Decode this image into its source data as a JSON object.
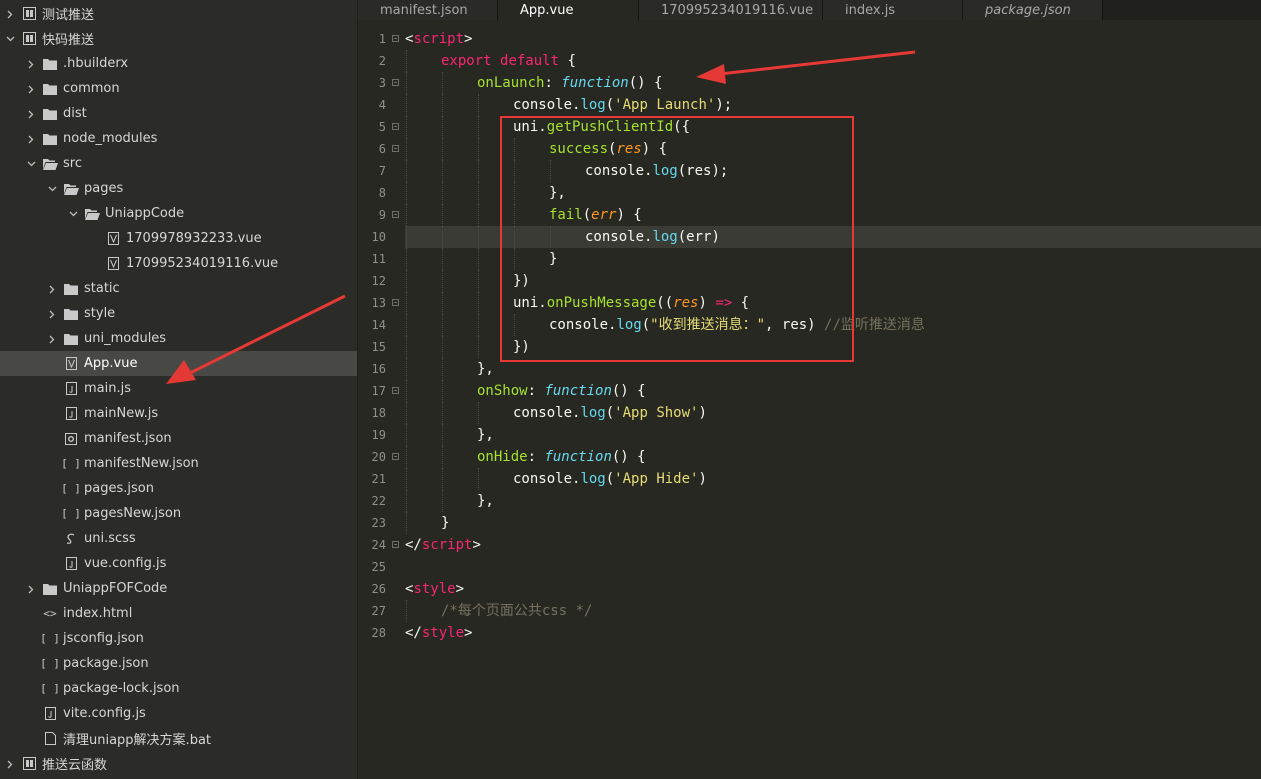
{
  "sidebar": {
    "rows": [
      {
        "label": "测试推送",
        "depth": 0,
        "expanded": false,
        "icon": "project-icon"
      },
      {
        "label": "快码推送",
        "depth": 0,
        "expanded": true,
        "icon": "project-icon"
      },
      {
        "label": ".hbuilderx",
        "depth": 1,
        "expanded": false,
        "icon": "folder-icon"
      },
      {
        "label": "common",
        "depth": 1,
        "expanded": false,
        "icon": "folder-icon"
      },
      {
        "label": "dist",
        "depth": 1,
        "expanded": false,
        "icon": "folder-icon"
      },
      {
        "label": "node_modules",
        "depth": 1,
        "expanded": false,
        "icon": "folder-icon"
      },
      {
        "label": "src",
        "depth": 1,
        "expanded": true,
        "icon": "folder-open-icon"
      },
      {
        "label": "pages",
        "depth": 2,
        "expanded": true,
        "icon": "folder-open-icon"
      },
      {
        "label": "UniappCode",
        "depth": 3,
        "expanded": true,
        "icon": "folder-open-icon"
      },
      {
        "label": "1709978932233.vue",
        "depth": 4,
        "icon": "vue-file-icon"
      },
      {
        "label": "170995234019116.vue",
        "depth": 4,
        "icon": "vue-file-icon"
      },
      {
        "label": "static",
        "depth": 2,
        "expanded": false,
        "icon": "folder-icon"
      },
      {
        "label": "style",
        "depth": 2,
        "expanded": false,
        "icon": "folder-icon"
      },
      {
        "label": "uni_modules",
        "depth": 2,
        "expanded": false,
        "icon": "folder-icon"
      },
      {
        "label": "App.vue",
        "depth": 2,
        "icon": "vue-file-icon",
        "selected": true
      },
      {
        "label": "main.js",
        "depth": 2,
        "icon": "js-file-icon"
      },
      {
        "label": "mainNew.js",
        "depth": 2,
        "icon": "js-file-icon"
      },
      {
        "label": "manifest.json",
        "depth": 2,
        "icon": "manifest-file-icon"
      },
      {
        "label": "manifestNew.json",
        "depth": 2,
        "icon": "json-file-icon"
      },
      {
        "label": "pages.json",
        "depth": 2,
        "icon": "json-file-icon"
      },
      {
        "label": "pagesNew.json",
        "depth": 2,
        "icon": "json-file-icon"
      },
      {
        "label": "uni.scss",
        "depth": 2,
        "icon": "scss-file-icon"
      },
      {
        "label": "vue.config.js",
        "depth": 2,
        "icon": "js-file-icon"
      },
      {
        "label": "UniappFOFCode",
        "depth": 1,
        "expanded": false,
        "icon": "folder-icon"
      },
      {
        "label": "index.html",
        "depth": 1,
        "icon": "html-file-icon"
      },
      {
        "label": "jsconfig.json",
        "depth": 1,
        "icon": "json-file-icon"
      },
      {
        "label": "package.json",
        "depth": 1,
        "icon": "json-file-icon"
      },
      {
        "label": "package-lock.json",
        "depth": 1,
        "icon": "json-file-icon"
      },
      {
        "label": "vite.config.js",
        "depth": 1,
        "icon": "js-file-icon"
      },
      {
        "label": "清理uniapp解决方案.bat",
        "depth": 1,
        "icon": "bat-file-icon"
      },
      {
        "label": "推送云函数",
        "depth": 0,
        "expanded": false,
        "icon": "project-icon"
      }
    ]
  },
  "tabs": [
    {
      "label": "manifest.json",
      "active": false,
      "italic": false
    },
    {
      "label": "App.vue",
      "active": true,
      "italic": false
    },
    {
      "label": "170995234019116.vue",
      "active": false,
      "italic": false
    },
    {
      "label": "index.js",
      "active": false,
      "italic": false
    },
    {
      "label": "package.json",
      "active": false,
      "italic": true
    }
  ],
  "editor": {
    "current_line": 10,
    "lines": [
      {
        "n": "1",
        "fold": true,
        "indent": 0,
        "tokens": [
          [
            "pun",
            "<"
          ],
          [
            "tag",
            "script"
          ],
          [
            "pun",
            ">"
          ]
        ]
      },
      {
        "n": "2",
        "fold": false,
        "indent": 1,
        "tokens": [
          [
            "kw",
            "export"
          ],
          [
            "pun",
            " "
          ],
          [
            "kw",
            "default"
          ],
          [
            "pun",
            " {"
          ]
        ]
      },
      {
        "n": "3",
        "fold": true,
        "indent": 2,
        "tokens": [
          [
            "fn",
            "onLaunch"
          ],
          [
            "pun",
            ": "
          ],
          [
            "fnkw",
            "function"
          ],
          [
            "pun",
            "() {"
          ]
        ]
      },
      {
        "n": "4",
        "fold": false,
        "indent": 3,
        "tokens": [
          [
            "pun",
            "console."
          ],
          [
            "prop",
            "log"
          ],
          [
            "pun",
            "("
          ],
          [
            "str",
            "'App Launch'"
          ],
          [
            "pun",
            ");"
          ]
        ]
      },
      {
        "n": "5",
        "fold": true,
        "indent": 3,
        "tokens": [
          [
            "pun",
            "uni."
          ],
          [
            "fn",
            "getPushClientId"
          ],
          [
            "pun",
            "({"
          ]
        ]
      },
      {
        "n": "6",
        "fold": true,
        "indent": 4,
        "tokens": [
          [
            "fn",
            "success"
          ],
          [
            "pun",
            "("
          ],
          [
            "param",
            "res"
          ],
          [
            "pun",
            ") {"
          ]
        ]
      },
      {
        "n": "7",
        "fold": false,
        "indent": 5,
        "tokens": [
          [
            "pun",
            "console."
          ],
          [
            "prop",
            "log"
          ],
          [
            "pun",
            "(res);"
          ]
        ]
      },
      {
        "n": "8",
        "fold": false,
        "indent": 4,
        "tokens": [
          [
            "pun",
            "},"
          ]
        ]
      },
      {
        "n": "9",
        "fold": true,
        "indent": 4,
        "tokens": [
          [
            "fn",
            "fail"
          ],
          [
            "pun",
            "("
          ],
          [
            "param",
            "err"
          ],
          [
            "pun",
            ") {"
          ]
        ]
      },
      {
        "n": "10",
        "fold": false,
        "indent": 5,
        "tokens": [
          [
            "pun",
            "console."
          ],
          [
            "prop",
            "log"
          ],
          [
            "pun",
            "(err)"
          ]
        ]
      },
      {
        "n": "11",
        "fold": false,
        "indent": 4,
        "tokens": [
          [
            "pun",
            "}"
          ]
        ]
      },
      {
        "n": "12",
        "fold": false,
        "indent": 3,
        "tokens": [
          [
            "pun",
            "})"
          ]
        ]
      },
      {
        "n": "13",
        "fold": true,
        "indent": 3,
        "tokens": [
          [
            "pun",
            "uni."
          ],
          [
            "fn",
            "onPushMessage"
          ],
          [
            "pun",
            "(("
          ],
          [
            "param",
            "res"
          ],
          [
            "pun",
            ") "
          ],
          [
            "kw",
            "=>"
          ],
          [
            "pun",
            " {"
          ]
        ]
      },
      {
        "n": "14",
        "fold": false,
        "indent": 4,
        "tokens": [
          [
            "pun",
            "console."
          ],
          [
            "prop",
            "log"
          ],
          [
            "pun",
            "("
          ],
          [
            "str",
            "\"收到推送消息：\""
          ],
          [
            "pun",
            ", res) "
          ],
          [
            "cmt",
            "//监听推送消息"
          ]
        ]
      },
      {
        "n": "15",
        "fold": false,
        "indent": 3,
        "tokens": [
          [
            "pun",
            "})"
          ]
        ]
      },
      {
        "n": "16",
        "fold": false,
        "indent": 2,
        "tokens": [
          [
            "pun",
            "},"
          ]
        ]
      },
      {
        "n": "17",
        "fold": true,
        "indent": 2,
        "tokens": [
          [
            "fn",
            "onShow"
          ],
          [
            "pun",
            ": "
          ],
          [
            "fnkw",
            "function"
          ],
          [
            "pun",
            "() {"
          ]
        ]
      },
      {
        "n": "18",
        "fold": false,
        "indent": 3,
        "tokens": [
          [
            "pun",
            "console."
          ],
          [
            "prop",
            "log"
          ],
          [
            "pun",
            "("
          ],
          [
            "str",
            "'App Show'"
          ],
          [
            "pun",
            ")"
          ]
        ]
      },
      {
        "n": "19",
        "fold": false,
        "indent": 2,
        "tokens": [
          [
            "pun",
            "},"
          ]
        ]
      },
      {
        "n": "20",
        "fold": true,
        "indent": 2,
        "tokens": [
          [
            "fn",
            "onHide"
          ],
          [
            "pun",
            ": "
          ],
          [
            "fnkw",
            "function"
          ],
          [
            "pun",
            "() {"
          ]
        ]
      },
      {
        "n": "21",
        "fold": false,
        "indent": 3,
        "tokens": [
          [
            "pun",
            "console."
          ],
          [
            "prop",
            "log"
          ],
          [
            "pun",
            "("
          ],
          [
            "str",
            "'App Hide'"
          ],
          [
            "pun",
            ")"
          ]
        ]
      },
      {
        "n": "22",
        "fold": false,
        "indent": 2,
        "tokens": [
          [
            "pun",
            "},"
          ]
        ]
      },
      {
        "n": "23",
        "fold": false,
        "indent": 1,
        "tokens": [
          [
            "pun",
            "}"
          ]
        ]
      },
      {
        "n": "24",
        "fold": true,
        "indent": 0,
        "tokens": [
          [
            "pun",
            "</"
          ],
          [
            "tag",
            "script"
          ],
          [
            "pun",
            ">"
          ]
        ]
      },
      {
        "n": "25",
        "fold": false,
        "indent": 0,
        "tokens": []
      },
      {
        "n": "26",
        "fold": false,
        "indent": 0,
        "tokens": [
          [
            "pun",
            "<"
          ],
          [
            "tag",
            "style"
          ],
          [
            "pun",
            ">"
          ]
        ]
      },
      {
        "n": "27",
        "fold": false,
        "indent": 1,
        "tokens": [
          [
            "cmt",
            "/*每个页面公共css */"
          ]
        ]
      },
      {
        "n": "28",
        "fold": false,
        "indent": 0,
        "tokens": [
          [
            "pun",
            "</"
          ],
          [
            "tag",
            "style"
          ],
          [
            "pun",
            ">"
          ]
        ]
      }
    ]
  },
  "colors": {
    "highlight_box": "#e53935",
    "annotation_arrow": "#e53935",
    "selected_row": "#484944"
  }
}
